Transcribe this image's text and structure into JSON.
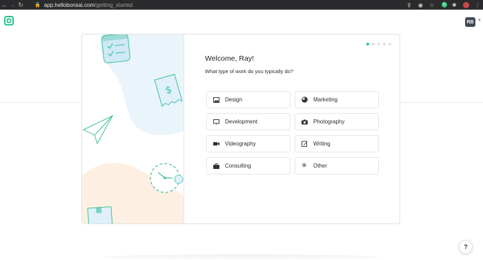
{
  "browser": {
    "url_host": "app.hellobonsai.com",
    "url_path": "/getting_started"
  },
  "header": {
    "user_initials": "RB"
  },
  "onboarding": {
    "title": "Welcome, Ray!",
    "question": "What type of work do you typically do?",
    "steps_total": 5,
    "current_step": 1,
    "options": [
      {
        "label": "Design",
        "icon": "image-icon"
      },
      {
        "label": "Marketing",
        "icon": "pie-chart-icon"
      },
      {
        "label": "Development",
        "icon": "monitor-icon"
      },
      {
        "label": "Photography",
        "icon": "camera-icon"
      },
      {
        "label": "Videography",
        "icon": "video-camera-icon"
      },
      {
        "label": "Writing",
        "icon": "pencil-icon"
      },
      {
        "label": "Consulting",
        "icon": "briefcase-icon"
      },
      {
        "label": "Other",
        "icon": "asterisk-icon"
      }
    ]
  },
  "help": {
    "label": "?"
  },
  "colors": {
    "accent": "#2bc28f",
    "illustration_blue": "#eaf4fb",
    "illustration_peach": "#fdf0e2",
    "avatar_bg": "#3f4a55"
  }
}
